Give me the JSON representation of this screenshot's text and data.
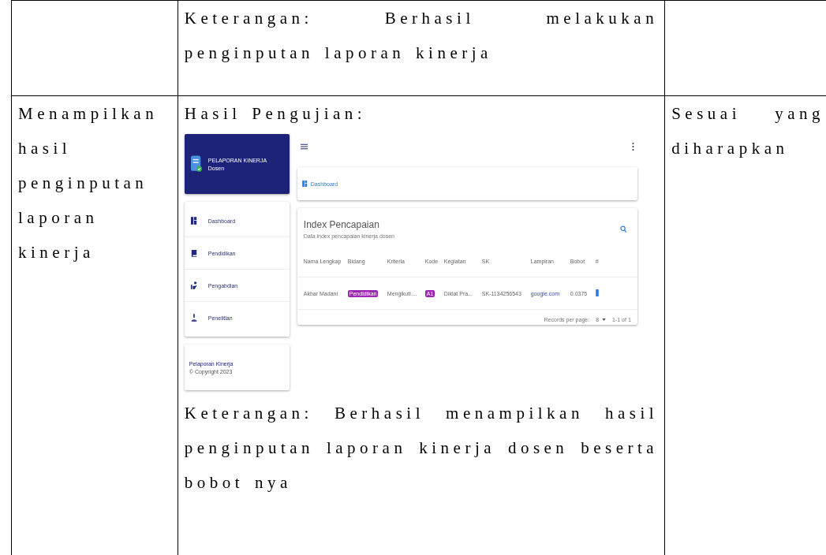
{
  "table": {
    "rows": [
      {
        "cell_1": "",
        "result": {
          "note": "Keterangan: Berhasil melakukan penginputan laporan kinerja"
        },
        "cell_3": ""
      },
      {
        "cell_1": "Menampilkan hasil penginputan laporan kinerja",
        "result": {
          "heading": "Hasil Pengujian:",
          "note": "Keterangan: Berhasil menampilkan hasil penginputan laporan kinerja dosen beserta bobot nya"
        },
        "cell_3": "Sesuai yang diharapkan"
      }
    ]
  },
  "app": {
    "brand": {
      "title": "PELAPORAN KINERJA",
      "subtitle": "Dosen"
    },
    "menu": [
      {
        "label": "Dashboard"
      },
      {
        "label": "Pendidikan"
      },
      {
        "label": "Pengabdian"
      },
      {
        "label": "Penelitian"
      }
    ],
    "footer": {
      "title": "Pelaporan Kinerja",
      "copyright": "© Copyright 2023"
    },
    "breadcrumb": "Dashboard",
    "card": {
      "title": "Index Pencapaian",
      "subtitle": "Data index pencapaian kinerja dosen",
      "columns": [
        "Nama Lengkap",
        "Bidang",
        "Kriteria",
        "Kode",
        "Kegiatan",
        "SK",
        "Lampiran",
        "Bobot",
        "#"
      ],
      "rows": [
        {
          "name": "Akbar Madani",
          "bidang": "Pendidikan",
          "kriteria": "Mengikuti ...",
          "kode": "A1",
          "kegiatan": "Diklat Pra...",
          "sk": "SK-1134256543",
          "lampiran": "google.com",
          "bobot": "0.0375"
        }
      ],
      "records_label": "Records per page:",
      "records_value": "8",
      "range": "1-1 of 1"
    }
  }
}
